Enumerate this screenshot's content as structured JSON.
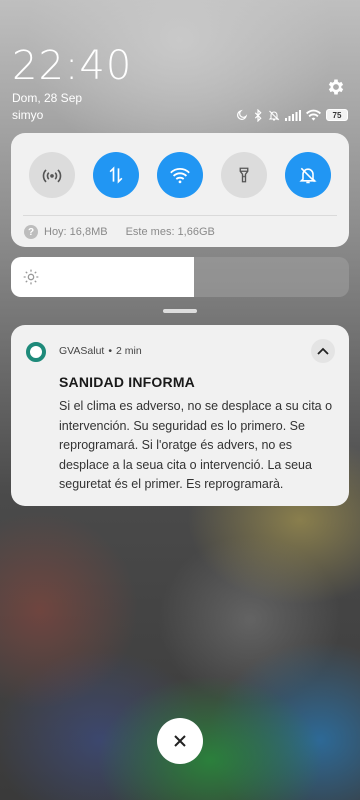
{
  "status": {
    "time": "22:40",
    "date": "Dom, 28 Sep",
    "carrier": "simyo",
    "battery": "75"
  },
  "icons": {
    "settings": "gear-icon",
    "moon": "do-not-disturb-icon",
    "bluetooth": "bluetooth-icon",
    "mute": "silent-icon",
    "signal": "signal-icon",
    "wifi": "wifi-icon"
  },
  "quick_settings": {
    "tiles": [
      {
        "name": "hotspot",
        "state": "off"
      },
      {
        "name": "mobile-data",
        "state": "on"
      },
      {
        "name": "wifi",
        "state": "on"
      },
      {
        "name": "flashlight",
        "state": "off"
      },
      {
        "name": "silent",
        "state": "on"
      }
    ],
    "data_usage": {
      "today": "Hoy: 16,8MB",
      "month": "Este mes: 1,66GB"
    },
    "accent_color": "#2196f3"
  },
  "brightness": {
    "level_percent": 54
  },
  "notification": {
    "app": "GVASalut",
    "separator": "•",
    "time": "2 min",
    "title": "SANIDAD INFORMA",
    "body": "Si el clima es adverso, no se desplace a su cita o intervención. Su seguridad es lo primero. Se reprogramará. Si l'oratge és advers, no es desplace a la seua cita o intervenció. La seua seguretat és el primer. Es reprogramarà.",
    "app_color": "#1e8a7a"
  },
  "close_button": {
    "icon": "close-icon"
  }
}
